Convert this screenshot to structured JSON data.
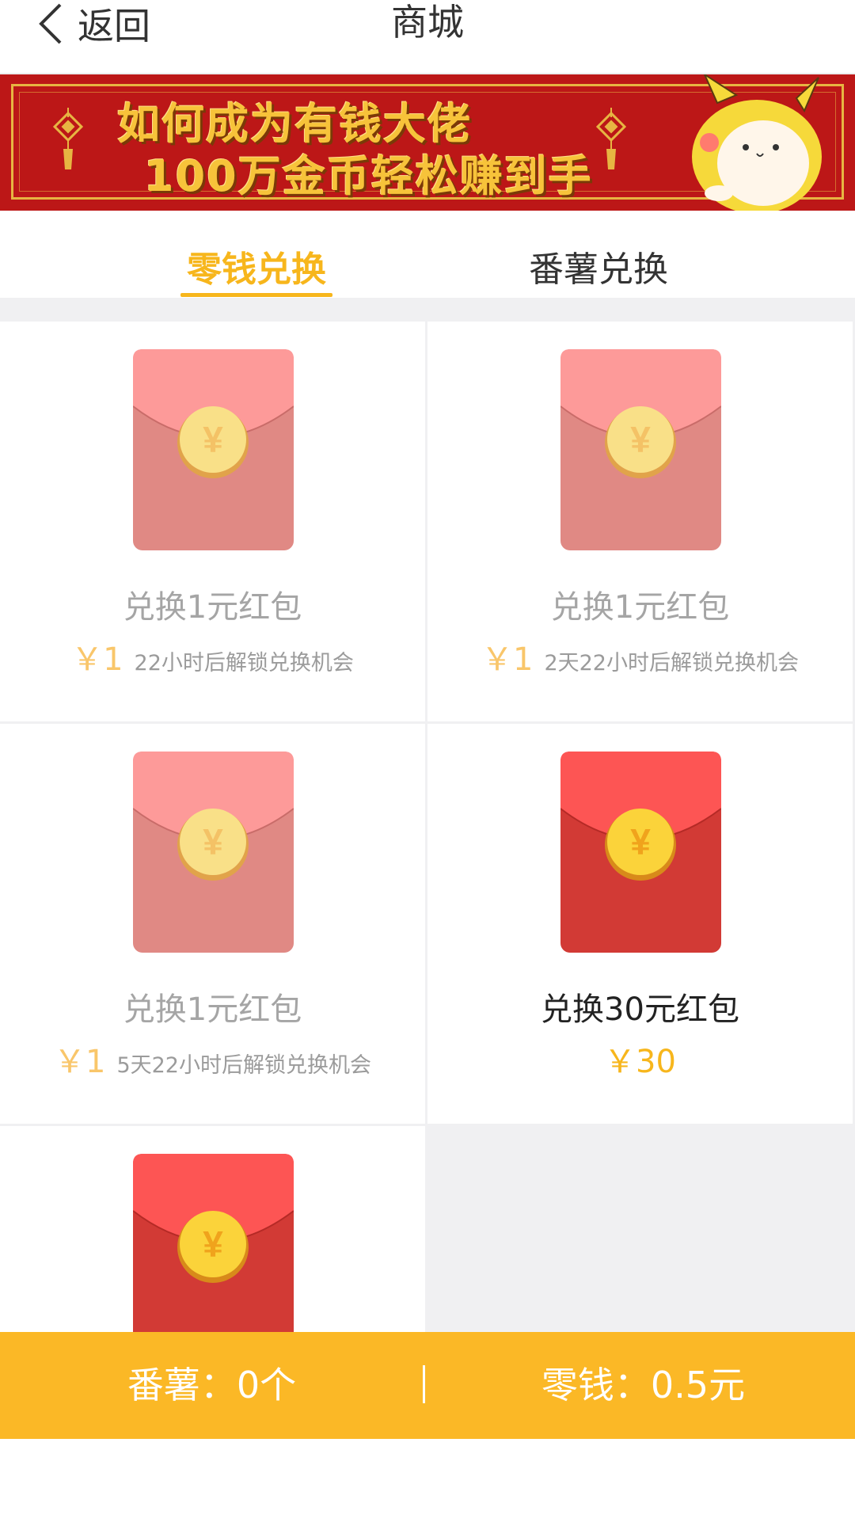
{
  "header": {
    "back_label": "返回",
    "title": "商城"
  },
  "banner": {
    "line1": "如何成为有钱大佬",
    "line2": "100万金币轻松赚到手"
  },
  "tabs": [
    {
      "label": "零钱兑换",
      "active": true
    },
    {
      "label": "番薯兑换",
      "active": false
    }
  ],
  "products": [
    {
      "title": "兑换1元红包",
      "price": "￥1",
      "unlock": "22小时后解锁兑换机会",
      "state": "locked"
    },
    {
      "title": "兑换1元红包",
      "price": "￥1",
      "unlock": "2天22小时后解锁兑换机会",
      "state": "locked"
    },
    {
      "title": "兑换1元红包",
      "price": "￥1",
      "unlock": "5天22小时后解锁兑换机会",
      "state": "locked"
    },
    {
      "title": "兑换30元红包",
      "price": "￥30",
      "unlock": "",
      "state": "available"
    },
    {
      "title": "",
      "price": "",
      "unlock": "",
      "state": "available"
    }
  ],
  "footer": {
    "fanshu": "番薯：0个",
    "lingqian": "零钱：0.5元"
  },
  "colors": {
    "accent": "#f7b61c",
    "footer_bg": "#fbb826",
    "envelope_active": "#d23a35",
    "envelope_locked": "#e08984",
    "banner_bg": "#bc1717"
  },
  "icons": {
    "back": "chevron-left-icon",
    "coin": "yuan-coin-icon"
  }
}
